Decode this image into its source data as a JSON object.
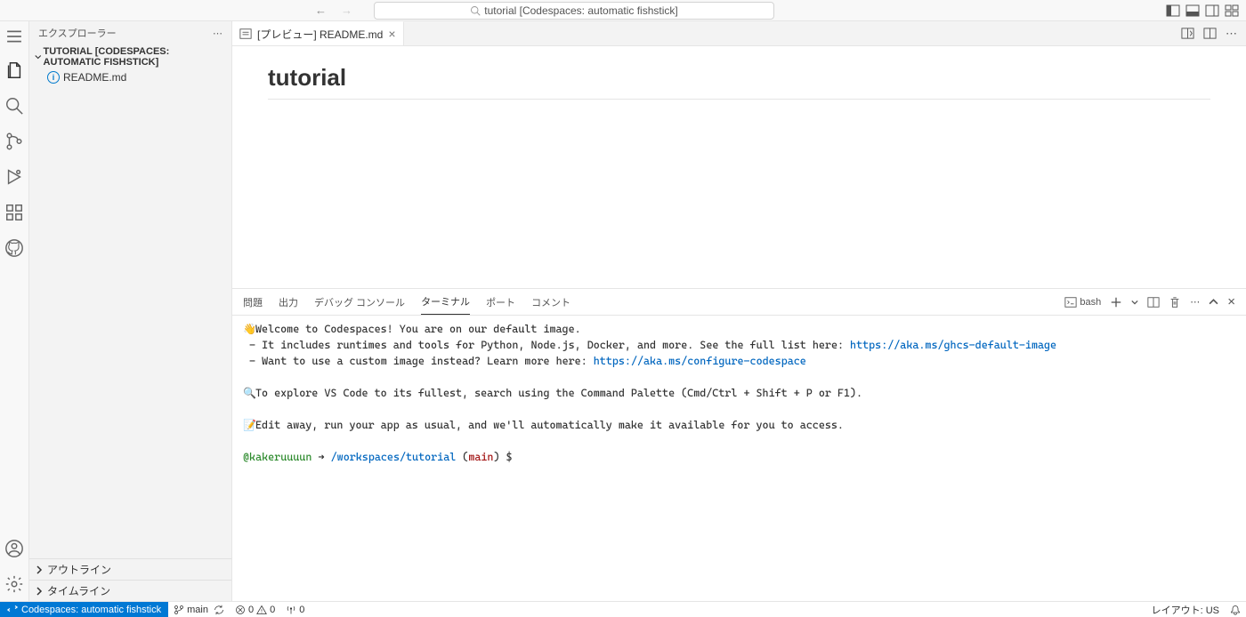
{
  "titlebar": {
    "search_text": "tutorial [Codespaces: automatic fishstick]"
  },
  "sidebar": {
    "title": "エクスプローラー",
    "folder_label": "TUTORIAL [CODESPACES: AUTOMATIC FISHSTICK]",
    "files": [
      {
        "name": "README.md"
      }
    ],
    "outline_label": "アウトライン",
    "timeline_label": "タイムライン"
  },
  "tab": {
    "label": "[プレビュー] README.md"
  },
  "editor": {
    "heading": "tutorial"
  },
  "panel": {
    "tabs": {
      "problems": "問題",
      "output": "出力",
      "debug": "デバッグ コンソール",
      "terminal": "ターミナル",
      "ports": "ポート",
      "comments": "コメント"
    },
    "shell": "bash"
  },
  "terminal": {
    "l1": "Welcome to Codespaces! You are on our default image.",
    "l2": " - It includes runtimes and tools for Python, Node.js, Docker, and more. See the full list here:",
    "l2_link": "https://aka.ms/ghcs-default-image",
    "l3": " - Want to use a custom image instead? Learn more here:",
    "l3_link": "https://aka.ms/configure-codespace",
    "l4": "To explore VS Code to its fullest, search using the Command Palette (Cmd/Ctrl + Shift + P or F1).",
    "l5": "Edit away, run your app as usual, and we'll automatically make it available for you to access.",
    "prompt_user": "@kakeruuuun",
    "prompt_arrow": " ➜ ",
    "prompt_path": "/workspaces/tutorial",
    "prompt_branch_open": " (",
    "prompt_branch": "main",
    "prompt_branch_close": ") ",
    "prompt_dollar": "$ "
  },
  "status": {
    "remote": "Codespaces: automatic fishstick",
    "branch": "main",
    "errors": "0",
    "warnings": "0",
    "ports": "0",
    "layout": "レイアウト: US"
  }
}
